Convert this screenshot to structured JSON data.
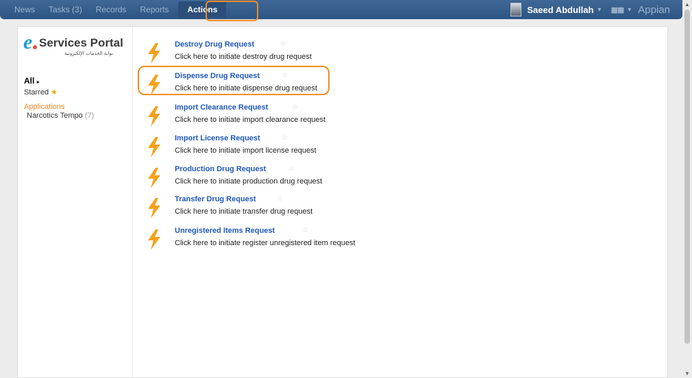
{
  "nav": {
    "items": [
      {
        "label": "News"
      },
      {
        "label": "Tasks (3)"
      },
      {
        "label": "Records"
      },
      {
        "label": "Reports"
      },
      {
        "label": "Actions"
      }
    ],
    "active": "Actions"
  },
  "user": {
    "name": "Saeed Abdullah",
    "caret": "▾",
    "brand": "Appian",
    "grid_icon": "apps-grid-icon"
  },
  "logo": {
    "text": "Services Portal",
    "arabic": "بوابة الخدمات الإلكترونية"
  },
  "sidebar": {
    "all_label": "All",
    "starred_label": "Starred",
    "applications_heading": "Applications",
    "app": {
      "name": "Narcotics Tempo",
      "count": "(7)"
    }
  },
  "actions": [
    {
      "title": "Destroy Drug Request",
      "desc": "Click here to initiate destroy drug request"
    },
    {
      "title": "Dispense Drug Request",
      "desc": "Click here to initiate dispense drug request"
    },
    {
      "title": "Import Clearance Request",
      "desc": "Click here to initiate import clearance request"
    },
    {
      "title": "Import License Request",
      "desc": "Click here to initiate import license request"
    },
    {
      "title": "Production Drug Request",
      "desc": "Click here to initiate production drug request"
    },
    {
      "title": "Transfer Drug Request",
      "desc": "Click here to initiate transfer drug request"
    },
    {
      "title": "Unregistered Items Request",
      "desc": "Click here to initiate register unregistered item request"
    }
  ],
  "colors": {
    "header": "#3a6291",
    "link": "#1f58b8",
    "bolt": "#f5a21b",
    "highlight": "#f28c1e"
  }
}
